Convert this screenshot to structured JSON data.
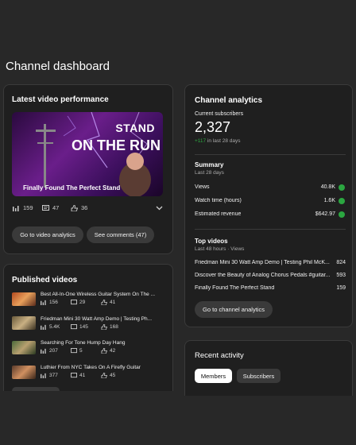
{
  "page_title": "Channel dashboard",
  "latest": {
    "title": "Latest video performance",
    "thumb_text_line1": "STAND",
    "thumb_text_line2": "ON THE RUN",
    "video_title": "Finally Found The Perfect Stand",
    "views": "159",
    "comments": "47",
    "likes": "36",
    "btn_analytics": "Go to video analytics",
    "btn_comments": "See comments (47)"
  },
  "published": {
    "title": "Published videos",
    "videos": [
      {
        "title": "Best All-In-One Wireless Guitar System On The ...",
        "views": "156",
        "comments": "29",
        "likes": "41"
      },
      {
        "title": "Friedman Mini 30 Watt Amp Demo | Testing Ph...",
        "views": "5.4K",
        "comments": "145",
        "likes": "168"
      },
      {
        "title": "Searching For Tone Hump Day Hang",
        "views": "207",
        "comments": "5",
        "likes": "42"
      },
      {
        "title": "Luthier From NYC Takes On A Firefly Guitar",
        "views": "377",
        "comments": "41",
        "likes": "45"
      }
    ]
  },
  "analytics": {
    "title": "Channel analytics",
    "subs_label": "Current subscribers",
    "subs_value": "2,327",
    "subs_delta": "+117",
    "subs_delta_period": "in last 28 days",
    "summary_title": "Summary",
    "summary_period": "Last 28 days",
    "summary_rows": [
      {
        "label": "Views",
        "value": "40.8K"
      },
      {
        "label": "Watch time (hours)",
        "value": "1.6K"
      },
      {
        "label": "Estimated revenue",
        "value": "$642.97"
      }
    ],
    "top_title": "Top videos",
    "top_period": "Last 48 hours · Views",
    "top_rows": [
      {
        "label": "Friedman Mini 30 Watt Amp Demo | Testing Phil McK...",
        "value": "824"
      },
      {
        "label": "Discover the Beauty of Analog Chorus Pedals #guitar...",
        "value": "593"
      },
      {
        "label": "Finally Found The Perfect Stand",
        "value": "159"
      }
    ],
    "btn_channel": "Go to channel analytics"
  },
  "activity": {
    "title": "Recent activity",
    "tab_members": "Members",
    "tab_subscribers": "Subscribers"
  },
  "colors": {
    "green": "#2ba640",
    "bg": "#282828",
    "card": "#1f1f1f"
  }
}
